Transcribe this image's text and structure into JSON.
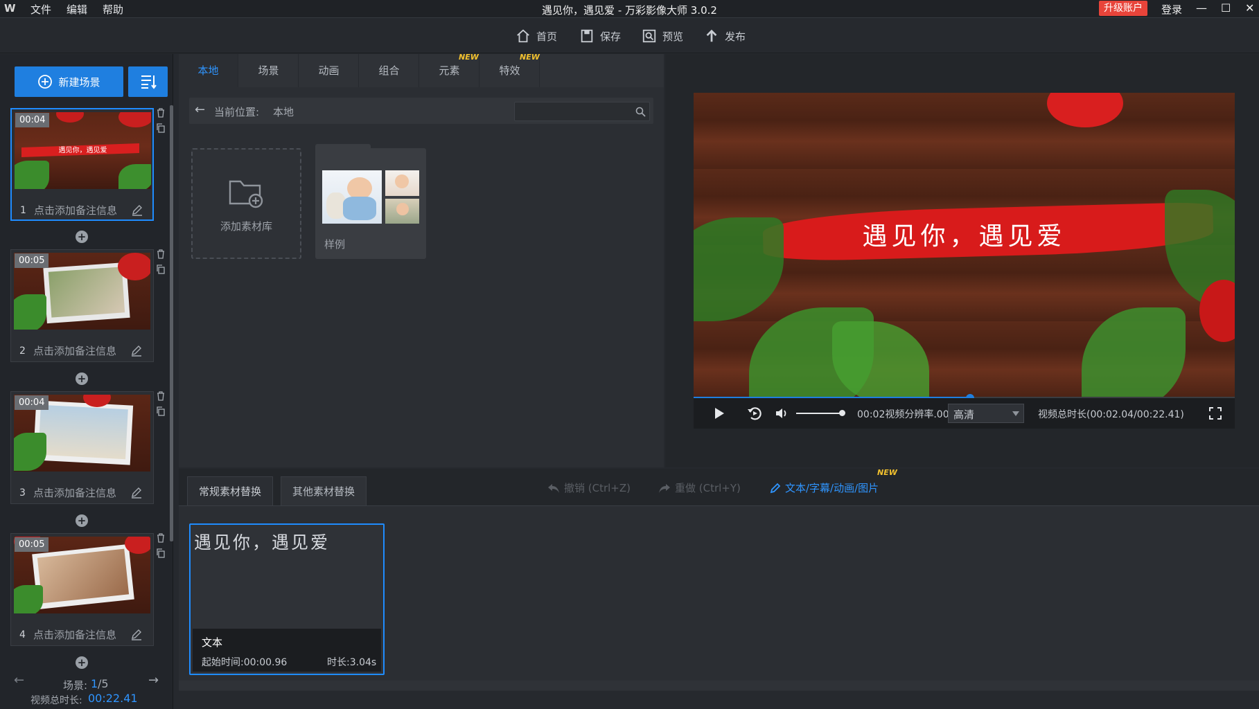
{
  "titlebar": {
    "logo": "W",
    "menu": [
      "文件",
      "编辑",
      "帮助"
    ],
    "title": "遇见你，遇见爱 - 万彩影像大师 3.0.2",
    "upgrade": "升级账户",
    "login": "登录",
    "controls": [
      "minimize-icon",
      "maximize-icon",
      "close-icon"
    ]
  },
  "toolbar": {
    "home": "首页",
    "save": "保存",
    "preview": "预览",
    "publish": "发布"
  },
  "left": {
    "new_scene": "新建场景",
    "scenes": [
      {
        "num": "1",
        "time": "00:04",
        "note": "点击添加备注信息",
        "caption": "遇见你，遇见爱"
      },
      {
        "num": "2",
        "time": "00:05",
        "note": "点击添加备注信息"
      },
      {
        "num": "3",
        "time": "00:04",
        "note": "点击添加备注信息"
      },
      {
        "num": "4",
        "time": "00:05",
        "note": "点击添加备注信息"
      }
    ],
    "scene_label": "场景:",
    "scene_current": "1",
    "scene_total": "/5",
    "total_label": "视频总时长:",
    "total_value": "00:22.41"
  },
  "library": {
    "tabs": [
      "本地",
      "场景",
      "动画",
      "组合",
      "元素",
      "特效"
    ],
    "active_tab": "本地",
    "new_badge": "NEW",
    "path_label": "当前位置:",
    "path_value": "本地",
    "search_placeholder": "",
    "add_library": "添加素材库",
    "sample": "样例"
  },
  "player": {
    "video_caption": "遇见你，遇见爱",
    "time_overlap": "00:02视频分辨率.00",
    "quality": "高清",
    "total_duration": "视频总时长(00:02.04/00:22.41)",
    "progress": 0.51,
    "volume": 0.8
  },
  "bottom": {
    "tabs": [
      "常规素材替换",
      "其他素材替换"
    ],
    "undo": "撤销 (Ctrl+Z)",
    "redo": "重做 (Ctrl+Y)",
    "text_link": "文本/字幕/动画/图片",
    "new_badge": "NEW",
    "card": {
      "text": "遇见你，遇见爱",
      "type": "文本",
      "start": "起始时间:00:00.96",
      "duration": "时长:3.04s"
    }
  }
}
